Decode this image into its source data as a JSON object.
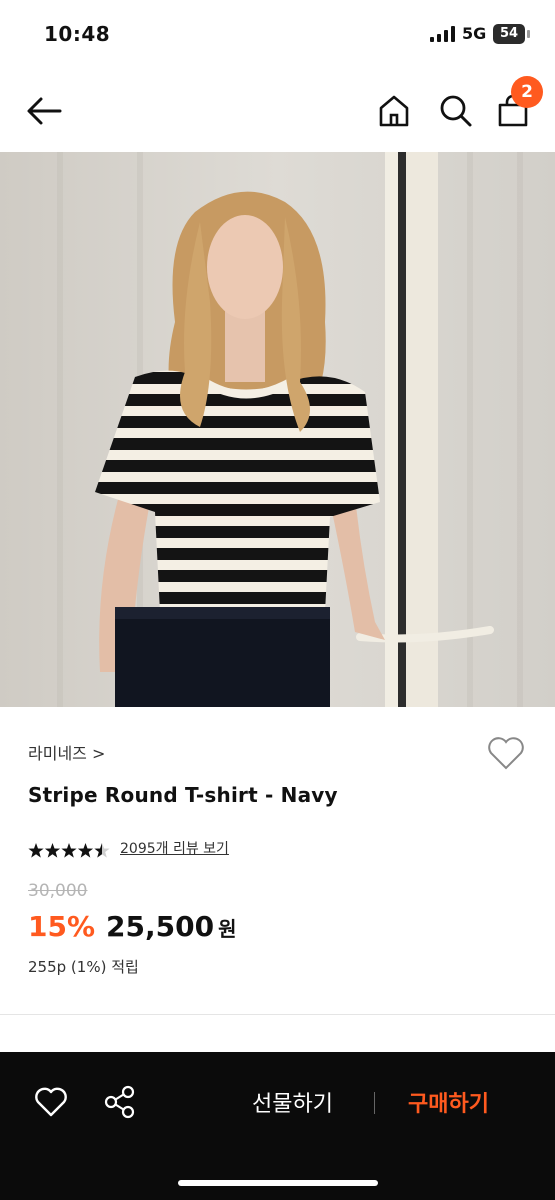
{
  "status": {
    "time": "10:48",
    "network": "5G",
    "battery": "54"
  },
  "header": {
    "cart_count": "2"
  },
  "product": {
    "brand": "라미네즈 >",
    "name": "Stripe Round T-shirt - Navy",
    "rating": 4.5,
    "review_link": "2095개 리뷰 보기",
    "original_price": "30,000",
    "discount": "15%",
    "price": "25,500",
    "currency": "원",
    "points": "255p (1%) 적립"
  },
  "bottom_bar": {
    "gift_label": "선물하기",
    "buy_label": "구매하기"
  },
  "colors": {
    "accent": "#ff5a1f",
    "bar_bg": "#0b0b0b"
  },
  "icons": [
    "back-arrow-icon",
    "home-icon",
    "search-icon",
    "cart-icon",
    "heart-icon",
    "share-icon",
    "star-icon"
  ]
}
